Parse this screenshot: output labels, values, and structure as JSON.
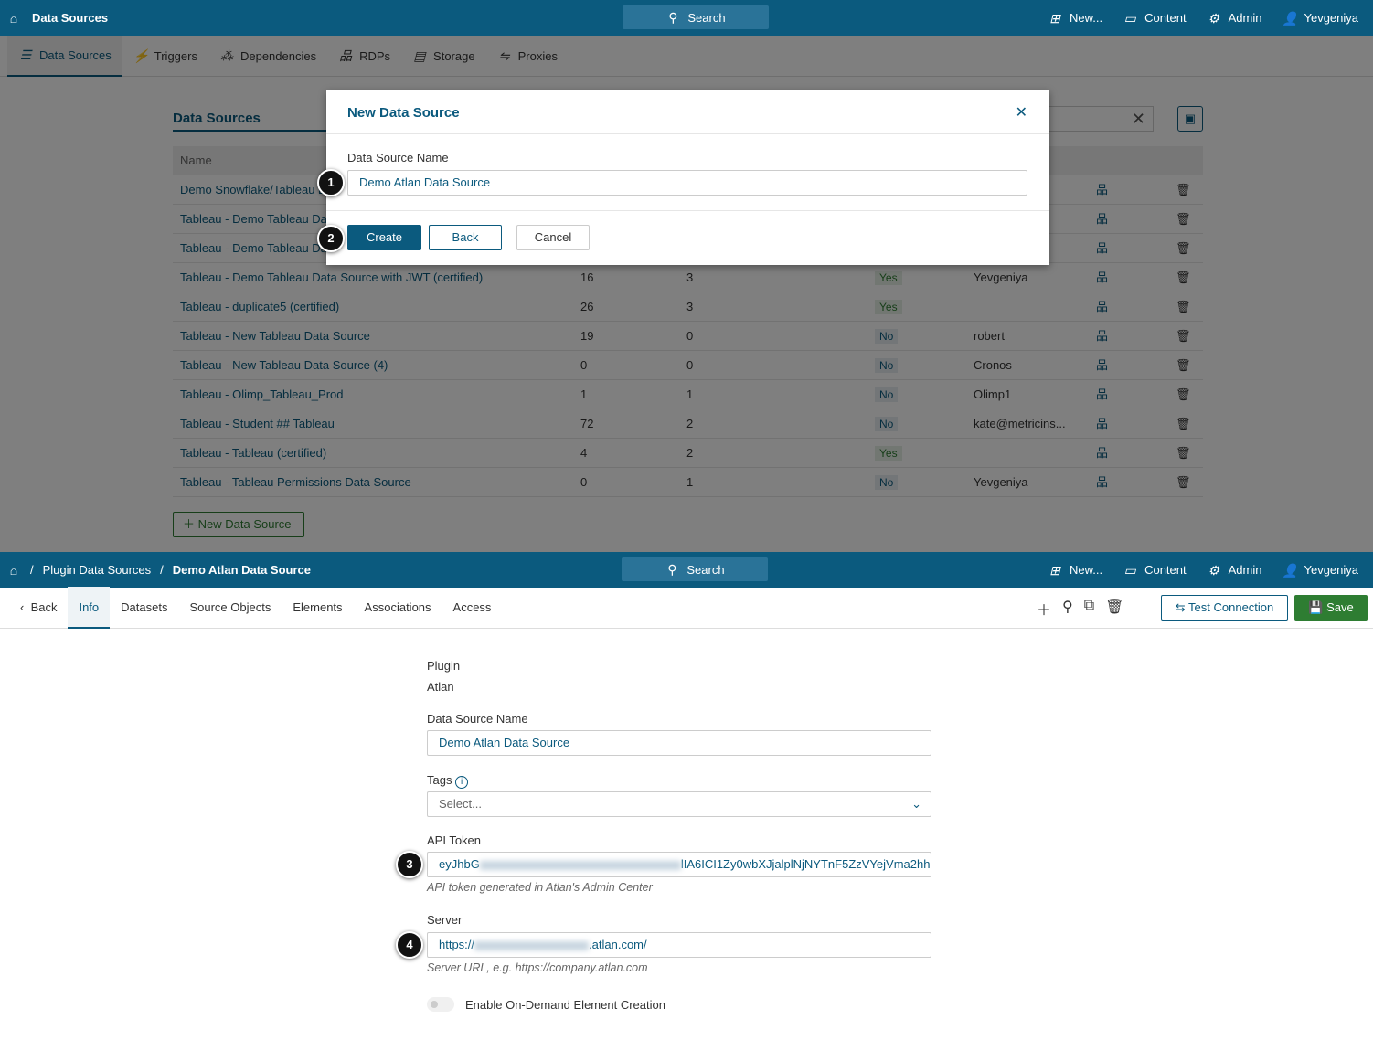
{
  "top_header": {
    "title": "Data Sources",
    "search": "Search",
    "new": "New...",
    "content": "Content",
    "admin": "Admin",
    "user": "Yevgeniya"
  },
  "subnav": [
    "Data Sources",
    "Triggers",
    "Dependencies",
    "RDPs",
    "Storage",
    "Proxies"
  ],
  "list": {
    "title": "Data Sources",
    "name_header": "Name",
    "new_button": "New Data Source",
    "rows": [
      {
        "name": "Demo Snowflake/Tableau D",
        "a": "",
        "b": "",
        "cert": "",
        "owner": ""
      },
      {
        "name": "Tableau - Demo Tableau Dat",
        "a": "",
        "b": "",
        "cert": "",
        "owner": ""
      },
      {
        "name": "Tableau - Demo Tableau Da",
        "a": "",
        "b": "",
        "cert": "",
        "owner": ""
      },
      {
        "name": "Tableau - Demo Tableau Data Source with JWT (certified)",
        "a": "16",
        "b": "3",
        "cert": "Yes",
        "owner": "Yevgeniya"
      },
      {
        "name": "Tableau - duplicate5 (certified)",
        "a": "26",
        "b": "3",
        "cert": "Yes",
        "owner": ""
      },
      {
        "name": "Tableau - New Tableau Data Source",
        "a": "19",
        "b": "0",
        "cert": "No",
        "owner": "robert"
      },
      {
        "name": "Tableau - New Tableau Data Source (4)",
        "a": "0",
        "b": "0",
        "cert": "No",
        "owner": "Cronos"
      },
      {
        "name": "Tableau - Olimp_Tableau_Prod",
        "a": "1",
        "b": "1",
        "cert": "No",
        "owner": "Olimp1"
      },
      {
        "name": "Tableau - Student ## Tableau",
        "a": "72",
        "b": "2",
        "cert": "No",
        "owner": "kate@metricins..."
      },
      {
        "name": "Tableau - Tableau (certified)",
        "a": "4",
        "b": "2",
        "cert": "Yes",
        "owner": ""
      },
      {
        "name": "Tableau - Tableau Permissions Data Source",
        "a": "0",
        "b": "1",
        "cert": "No",
        "owner": "Yevgeniya"
      }
    ]
  },
  "modal": {
    "title": "New Data Source",
    "field_label": "Data Source Name",
    "field_value": "Demo Atlan Data Source",
    "create": "Create",
    "back": "Back",
    "cancel": "Cancel"
  },
  "badges": [
    "1",
    "2",
    "3",
    "4"
  ],
  "bottom_header": {
    "breadcrumb": [
      "Plugin Data Sources",
      "Demo Atlan Data Source"
    ],
    "search": "Search",
    "new": "New...",
    "content": "Content",
    "admin": "Admin",
    "user": "Yevgeniya"
  },
  "tabs": {
    "back": "Back",
    "items": [
      "Info",
      "Datasets",
      "Source Objects",
      "Elements",
      "Associations",
      "Access"
    ],
    "test": "Test Connection",
    "save": "Save"
  },
  "form": {
    "plugin_label": "Plugin",
    "plugin_value": "Atlan",
    "name_label": "Data Source Name",
    "name_value": "Demo Atlan Data Source",
    "tags_label": "Tags",
    "tags_placeholder": "Select...",
    "token_label": "API Token",
    "token_start": "eyJhbG",
    "token_end": "lIA6ICI1Zy0wbXJjalplNjNYTnF5ZzVYejVma2hh",
    "token_help": "API token generated in Atlan's Admin Center",
    "server_label": "Server",
    "server_start": "https://",
    "server_end": ".atlan.com/",
    "server_help": "Server URL, e.g. https://company.atlan.com",
    "toggle_label": "Enable On-Demand Element Creation",
    "toggle_on": false
  },
  "colors": {
    "brand": "#0b5a7e",
    "save": "#2e7d32"
  }
}
